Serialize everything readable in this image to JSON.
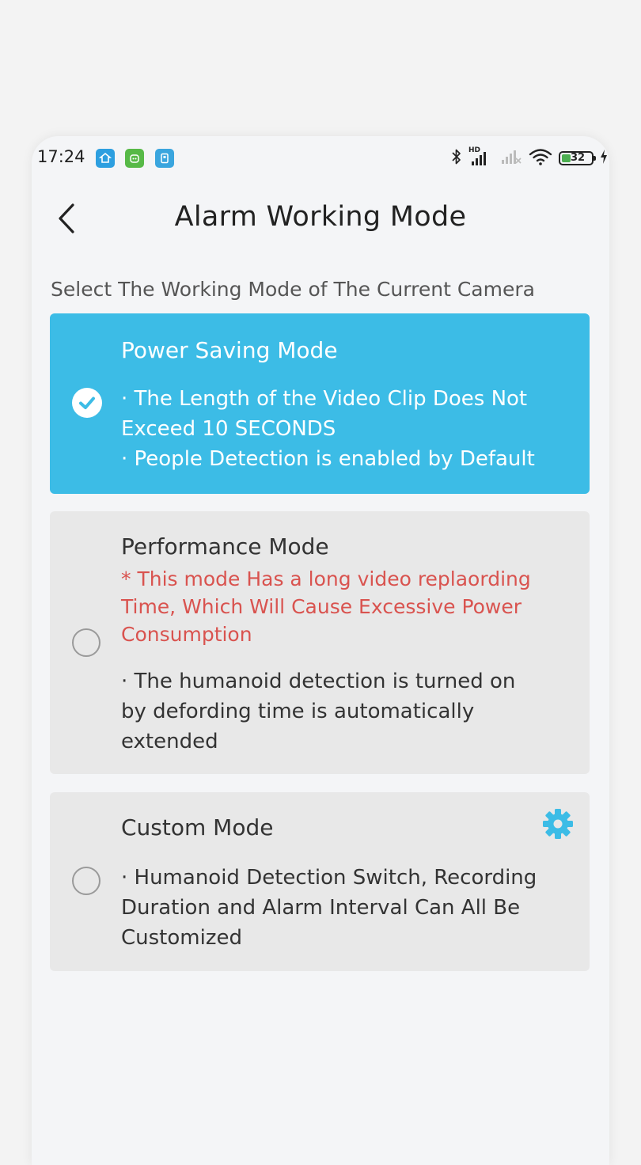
{
  "status_bar": {
    "time": "17:24",
    "signal_label": "HD",
    "battery_level": "32"
  },
  "header": {
    "title": "Alarm Working Mode"
  },
  "subtitle": "Select The Working Mode of The Current Camera",
  "modes": [
    {
      "title": "Power Saving Mode",
      "selected": true,
      "desc_1": "· The Length of the Video Clip Does Not Exceed 10 SECONDS",
      "desc_2": "· People Detection is enabled by Default"
    },
    {
      "title": "Performance Mode",
      "selected": false,
      "warning": "* This mode Has a long video replaording Time, Which Will Cause Excessive Power Consumption",
      "desc_1": "· The humanoid detection is turned on by defording time is automatically extended"
    },
    {
      "title": "Custom Mode",
      "selected": false,
      "desc_1": "· Humanoid Detection Switch, Recording Duration and Alarm Interval Can All Be Customized"
    }
  ],
  "colors": {
    "accent": "#3cbce6",
    "warning": "#d9534f",
    "card_inactive": "#e8e8e8",
    "background": "#f4f5f7"
  },
  "icons": {
    "back": "chevron-left-icon",
    "check": "check-icon",
    "settings": "gear-icon"
  }
}
